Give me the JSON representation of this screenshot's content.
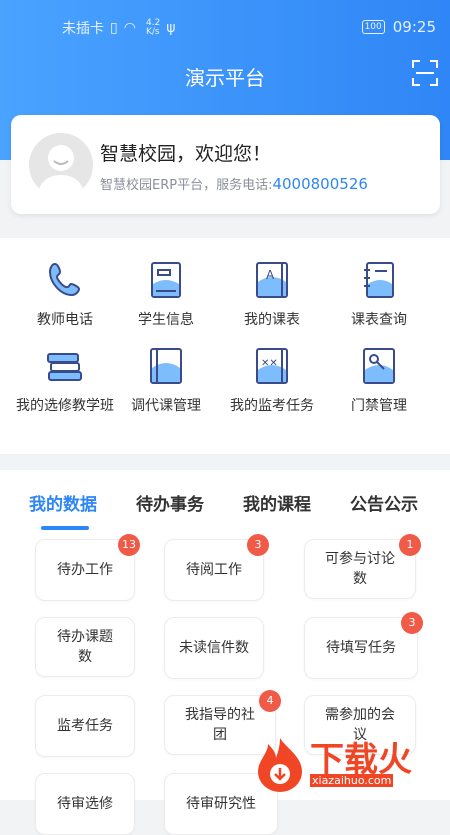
{
  "status_bar": {
    "carrier": "未插卡",
    "net_speed_value": "4.2",
    "net_speed_unit": "K/s",
    "battery": "100",
    "time": "09:25"
  },
  "header": {
    "title": "演示平台",
    "scan_icon": "scan-icon"
  },
  "profile": {
    "welcome": "智慧校园，欢迎您！",
    "subtitle": "智慧校园ERP平台，服务电话:",
    "phone": "4000800526"
  },
  "quick_menu": [
    {
      "label": "教师电话",
      "icon": "phone-icon"
    },
    {
      "label": "学生信息",
      "icon": "student-card-icon"
    },
    {
      "label": "我的课表",
      "icon": "schedule-book-icon"
    },
    {
      "label": "课表查询",
      "icon": "notebook-icon"
    },
    {
      "label": "我的选修教学班",
      "icon": "books-stack-icon"
    },
    {
      "label": "调代课管理",
      "icon": "book-icon"
    },
    {
      "label": "我的监考任务",
      "icon": "exam-book-icon"
    },
    {
      "label": "门禁管理",
      "icon": "key-book-icon"
    }
  ],
  "tabs": [
    "我的数据",
    "待办事务",
    "我的课程",
    "公告公示"
  ],
  "data_cells": [
    {
      "label": "待办工作",
      "badge": "13"
    },
    {
      "label": "待阅工作",
      "badge": "3"
    },
    {
      "label": "可参与讨论数",
      "badge": "1"
    },
    {
      "label": "待办课题数",
      "badge": ""
    },
    {
      "label": "未读信件数",
      "badge": ""
    },
    {
      "label": "待填写任务",
      "badge": "3"
    },
    {
      "label": "监考任务",
      "badge": ""
    },
    {
      "label": "我指导的社团",
      "badge": "4"
    },
    {
      "label": "需参加的会议",
      "badge": ""
    },
    {
      "label": "待审选修",
      "badge": ""
    },
    {
      "label": "待审研究性",
      "badge": ""
    }
  ],
  "watermark": {
    "title": "下载火",
    "url": "xiazaihuo.com"
  },
  "colors": {
    "primary": "#2f86f6",
    "badge": "#f05a47",
    "watermark": "#f04626"
  }
}
